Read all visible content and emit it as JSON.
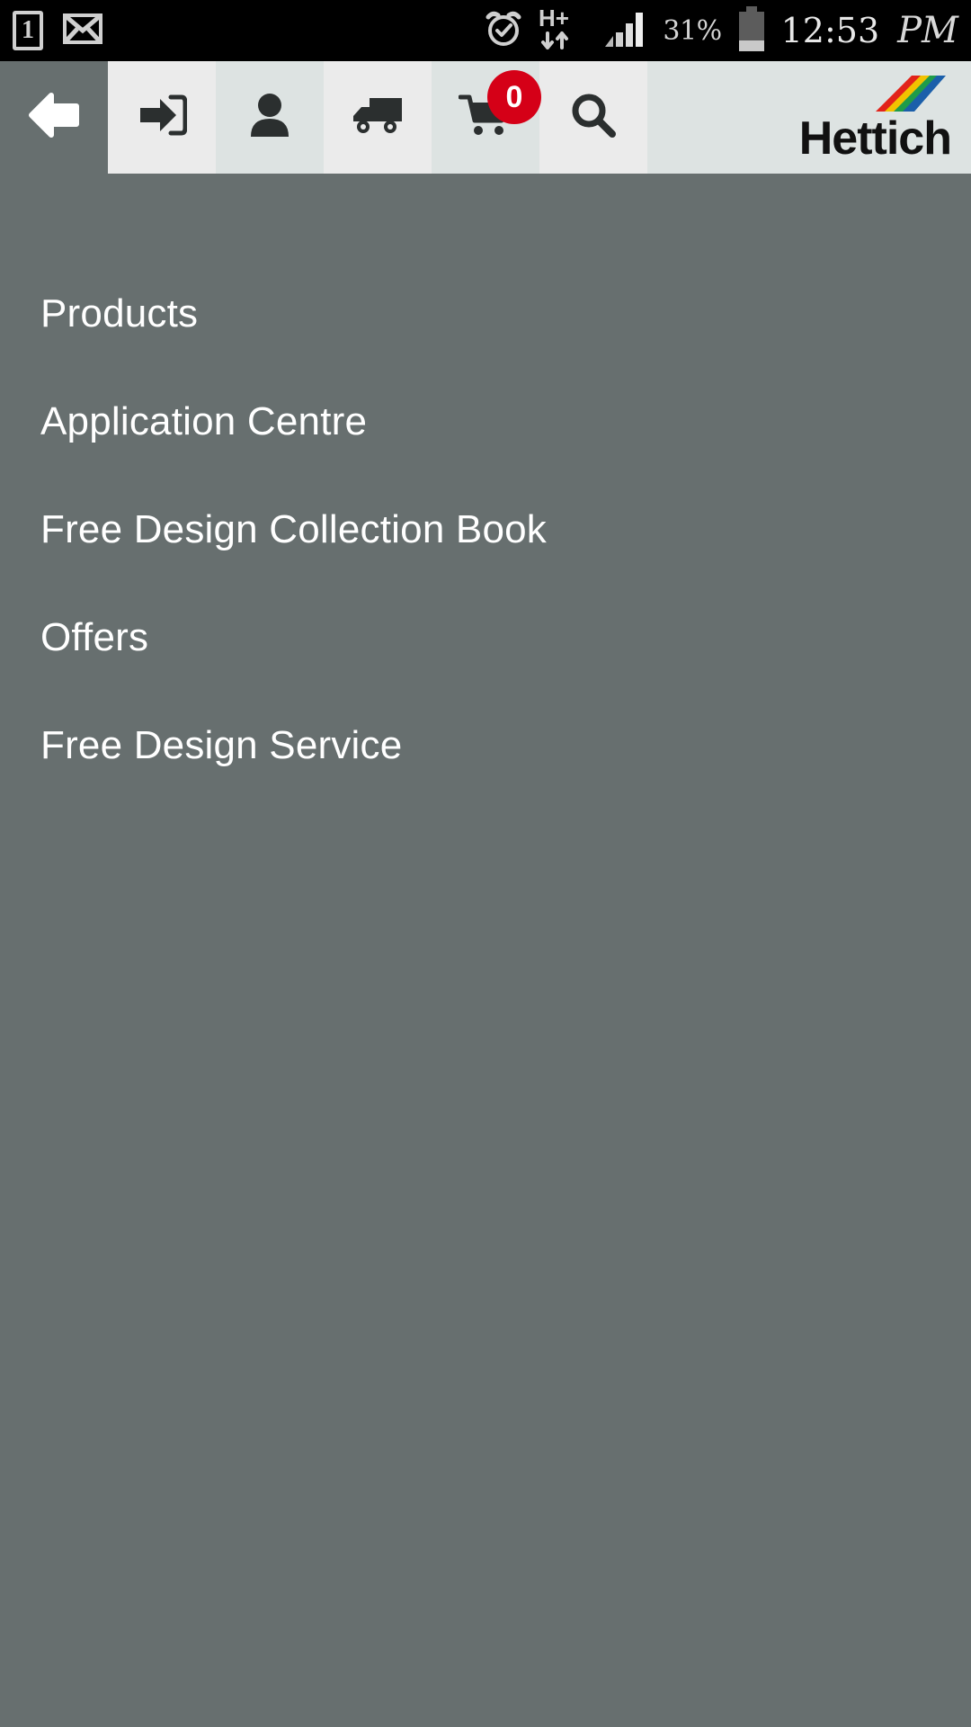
{
  "status_bar": {
    "left_icons": [
      {
        "name": "notification-count-badge",
        "value": "1"
      },
      {
        "name": "mail-icon",
        "value": "envelope"
      }
    ],
    "right_icons": [
      {
        "name": "alarm-clock-icon",
        "value": "alarm"
      },
      {
        "name": "network-type-icon",
        "value": "H+"
      },
      {
        "name": "signal-bars-icon",
        "value": "4 bars"
      }
    ],
    "battery_percent": "31%",
    "time": "12:53",
    "meridiem": "PM"
  },
  "toolbar": {
    "back_label": "back",
    "items": [
      {
        "name": "login-icon",
        "label": "Login"
      },
      {
        "name": "account-icon",
        "label": "My Account"
      },
      {
        "name": "delivery-truck-icon",
        "label": "Delivery"
      },
      {
        "name": "shopping-cart-icon",
        "label": "Cart"
      },
      {
        "name": "search-icon",
        "label": "Search"
      }
    ],
    "cart_count": "0",
    "brand": "Hettich",
    "brand_stripe_colors": [
      "#1b5faa",
      "#1f9c4a",
      "#f2c200",
      "#e2231a"
    ]
  },
  "menu": {
    "items": [
      {
        "label": "Products"
      },
      {
        "label": "Application Centre"
      },
      {
        "label": "Free Design Collection Book"
      },
      {
        "label": "Offers"
      },
      {
        "label": "Free Design Service"
      }
    ]
  },
  "colors": {
    "page_background": "#676f6f",
    "toolbar_light": "#ebebeb",
    "toolbar_tint": "#dde3e2",
    "badge_red": "#d50017",
    "text_white": "#ffffff"
  }
}
